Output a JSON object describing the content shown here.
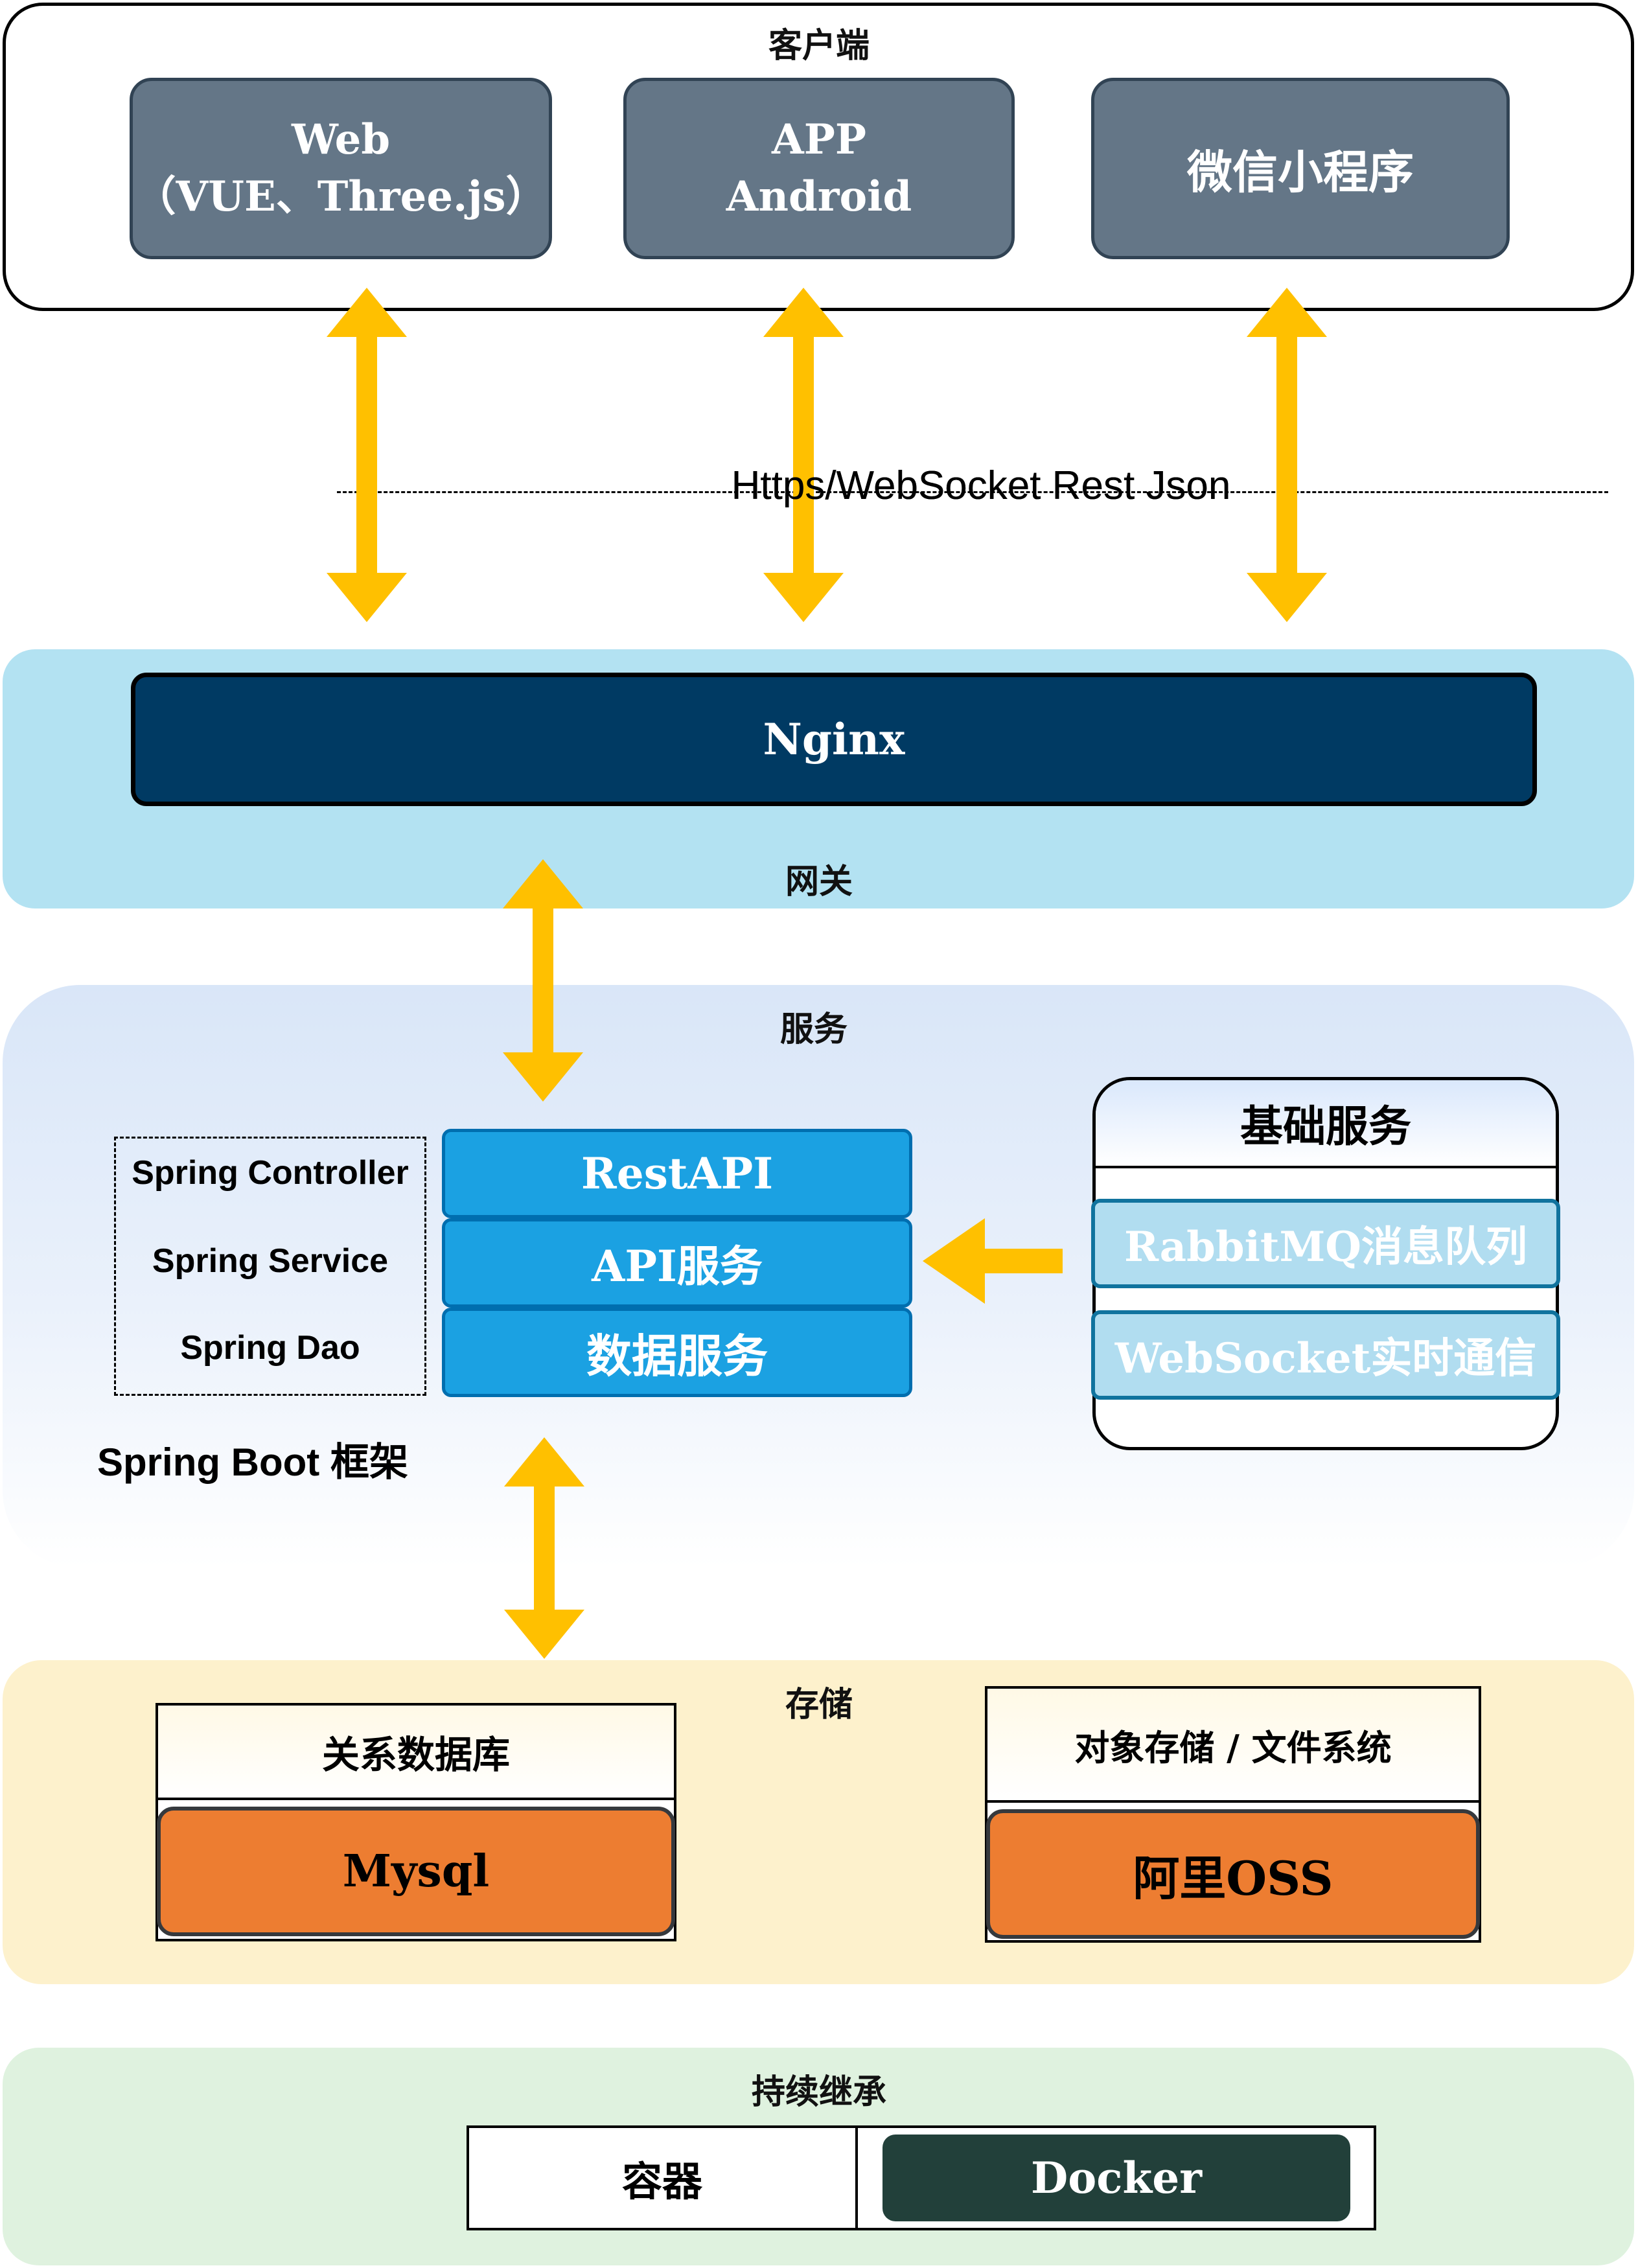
{
  "client": {
    "title": "客户端",
    "web": {
      "line1": "Web",
      "line2": "（VUE、Three.js）"
    },
    "app": {
      "line1": "APP",
      "line2": "Android"
    },
    "wechat": "微信小程序"
  },
  "protocol_label": "Https/WebSocket Rest Json",
  "gateway": {
    "title": "网关",
    "nginx": "Nginx"
  },
  "services": {
    "title": "服务",
    "spring_layers": [
      "Spring Controller",
      "Spring Service",
      "Spring Dao"
    ],
    "api_stack": [
      "RestAPI",
      "API服务",
      "数据服务"
    ],
    "framework_label": "Spring Boot 框架",
    "base": {
      "title": "基础服务",
      "items": [
        "RabbitMQ消息队列",
        "WebSocket实时通信"
      ]
    }
  },
  "storage": {
    "title": "存储",
    "db": {
      "header": "关系数据库",
      "name": "Mysql"
    },
    "oss": {
      "header": "对象存储 / 文件系统",
      "name": "阿里OSS"
    }
  },
  "ci": {
    "title": "持续继承",
    "container_label": "容器",
    "docker": "Docker"
  },
  "colors": {
    "arrow": "#ffc000",
    "client_box": "#647687",
    "nginx": "#003a63",
    "api_blue": "#1ba1e2",
    "base_item": "#b1ddf0",
    "storage_box": "#ed7d31",
    "docker": "#22403a",
    "gateway_bg": "#b3e2f2",
    "storage_bg": "#fdf1cc",
    "ci_bg": "#dff2df"
  }
}
